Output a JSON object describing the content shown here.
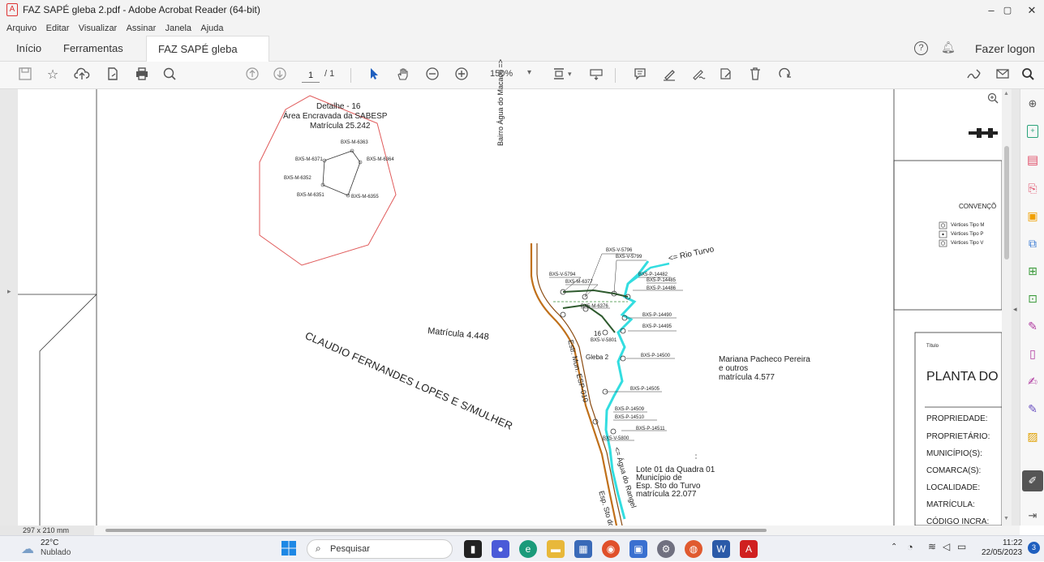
{
  "window": {
    "title": "FAZ SAPÉ gleba 2.pdf - Adobe Acrobat Reader (64-bit)",
    "minimize": "–",
    "restore": "▢",
    "close": "✕"
  },
  "menu": [
    "Arquivo",
    "Editar",
    "Visualizar",
    "Assinar",
    "Janela",
    "Ajuda"
  ],
  "tabs": {
    "home": "Início",
    "tools": "Ferramentas",
    "doc": "FAZ SAPÉ gleba 2.pdf",
    "doc_close": "×",
    "login": "Fazer logon"
  },
  "toolbar": {
    "page_current": "1",
    "page_total": "/ 1",
    "zoom": "150%"
  },
  "status": {
    "page_size": "297 x 210 mm"
  },
  "map": {
    "detail_title": "Detalhe - 16",
    "detail_area": "Área Encravada da SABESP",
    "detail_matricula": "Matrícula 25.242",
    "bx_6363": "BX5-M-6363",
    "bx_6371": "BX5-M-6371",
    "bx_6364": "BX5-M-6364",
    "bx_6352": "BX5-M-6352",
    "bx_6351": "BX5-M-6351",
    "bx_6355": "BX5-M-6355",
    "bairro": "Bairro Água do Macaco =>",
    "matricula_4448": "Matrícula 4.448",
    "claudio": "CLAUDIO FERNANDES LOPES E S/MULHER",
    "rio_turvo": "<= Rio Turvo",
    "gleba": "Gleba 2",
    "estr": "Estr. Mun. ESP-010",
    "mariana1": "Mariana Pacheco Pereira",
    "mariana2": "e outros",
    "mariana3": "matrícula 4.577",
    "lote1": "Lote 01 da Quadra 01",
    "lote2": "Município de",
    "lote3": "Esp. Sto do Turvo",
    "lote4": "matrícula 22.077",
    "agua_rangel": "<= Água do Rangel",
    "esp_sto": "Esp. Sto do",
    "v5796": "BX5-V-5796",
    "v5799": "BX5-V-5799",
    "v5794": "BX5-V-5794",
    "m6377": "BX5-M-6377",
    "p14482": "BX5-P-14482",
    "p14485": "BX5-P-14485",
    "p14486": "BX5-P-14486",
    "m6376": "BX5-M-6376",
    "p14490": "BX5-P-14490",
    "p14495": "BX5-P-14495",
    "v5801": "BX5-V-5801",
    "p14500": "BX5-P-14500",
    "p14505": "BX5-P-14505",
    "p14509": "BX5-P-14509",
    "p14510": "BX5-P-14510",
    "p14511": "BX5-P-14511",
    "v5800": "BX5-V-5800",
    "n16": "16"
  },
  "legend": {
    "title": "CONVENÇÕ",
    "item1": "Vértices Tipo M",
    "item2": "Vértices Tipo P",
    "item3": "Vértices Tipo V"
  },
  "titleblock": {
    "titulo_label": "Título",
    "titulo": "PLANTA DO",
    "fields": [
      "PROPRIEDADE:",
      "PROPRIETÁRIO:",
      "MUNICÍPIO(S):",
      "COMARCA(S):",
      "LOCALIDADE:",
      "MATRÍCULA:",
      "CÓDIGO INCRA:"
    ]
  },
  "taskbar": {
    "temp": "22°C",
    "weather": "Nublado",
    "search": "Pesquisar",
    "time": "11:22",
    "date": "22/05/2023",
    "notif": "3"
  },
  "colors": {
    "river": "#33dde0",
    "road": "#c0701a",
    "octagon": "#e05a5a",
    "boundary": "#2e5a2e"
  }
}
